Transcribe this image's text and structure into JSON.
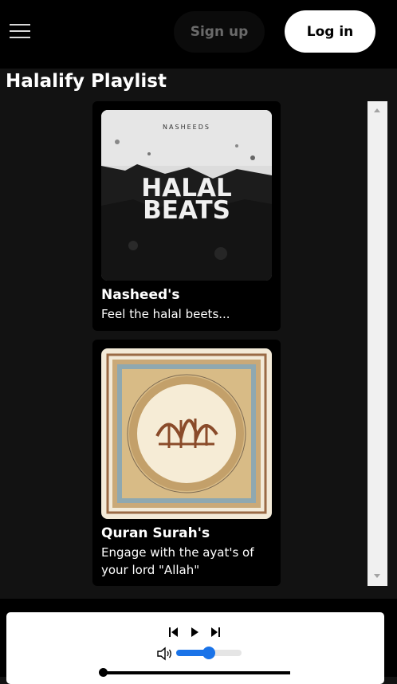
{
  "header": {
    "menu_icon": "hamburger-menu-icon",
    "signup_label": "Sign up",
    "login_label": "Log in"
  },
  "page": {
    "title": "Halalify Playlist"
  },
  "playlists": [
    {
      "cover_label": "NASHEEDS",
      "cover_line1": "HALAL",
      "cover_line2": "BEATS",
      "title": "Nasheed's",
      "description": "Feel the halal beets..."
    },
    {
      "title": "Quran Surah's",
      "description": "Engage with the ayat's of your lord \"Allah\""
    }
  ],
  "player": {
    "icons": {
      "previous": "skip-previous-icon",
      "play": "play-icon",
      "next": "skip-next-icon",
      "volume": "speaker-volume-icon"
    },
    "volume_level": 0.5,
    "progress": 0.0
  },
  "colors": {
    "background": "#121212",
    "header": "#000000",
    "accent": "#1a73e8",
    "login_button": "#ffffff"
  }
}
